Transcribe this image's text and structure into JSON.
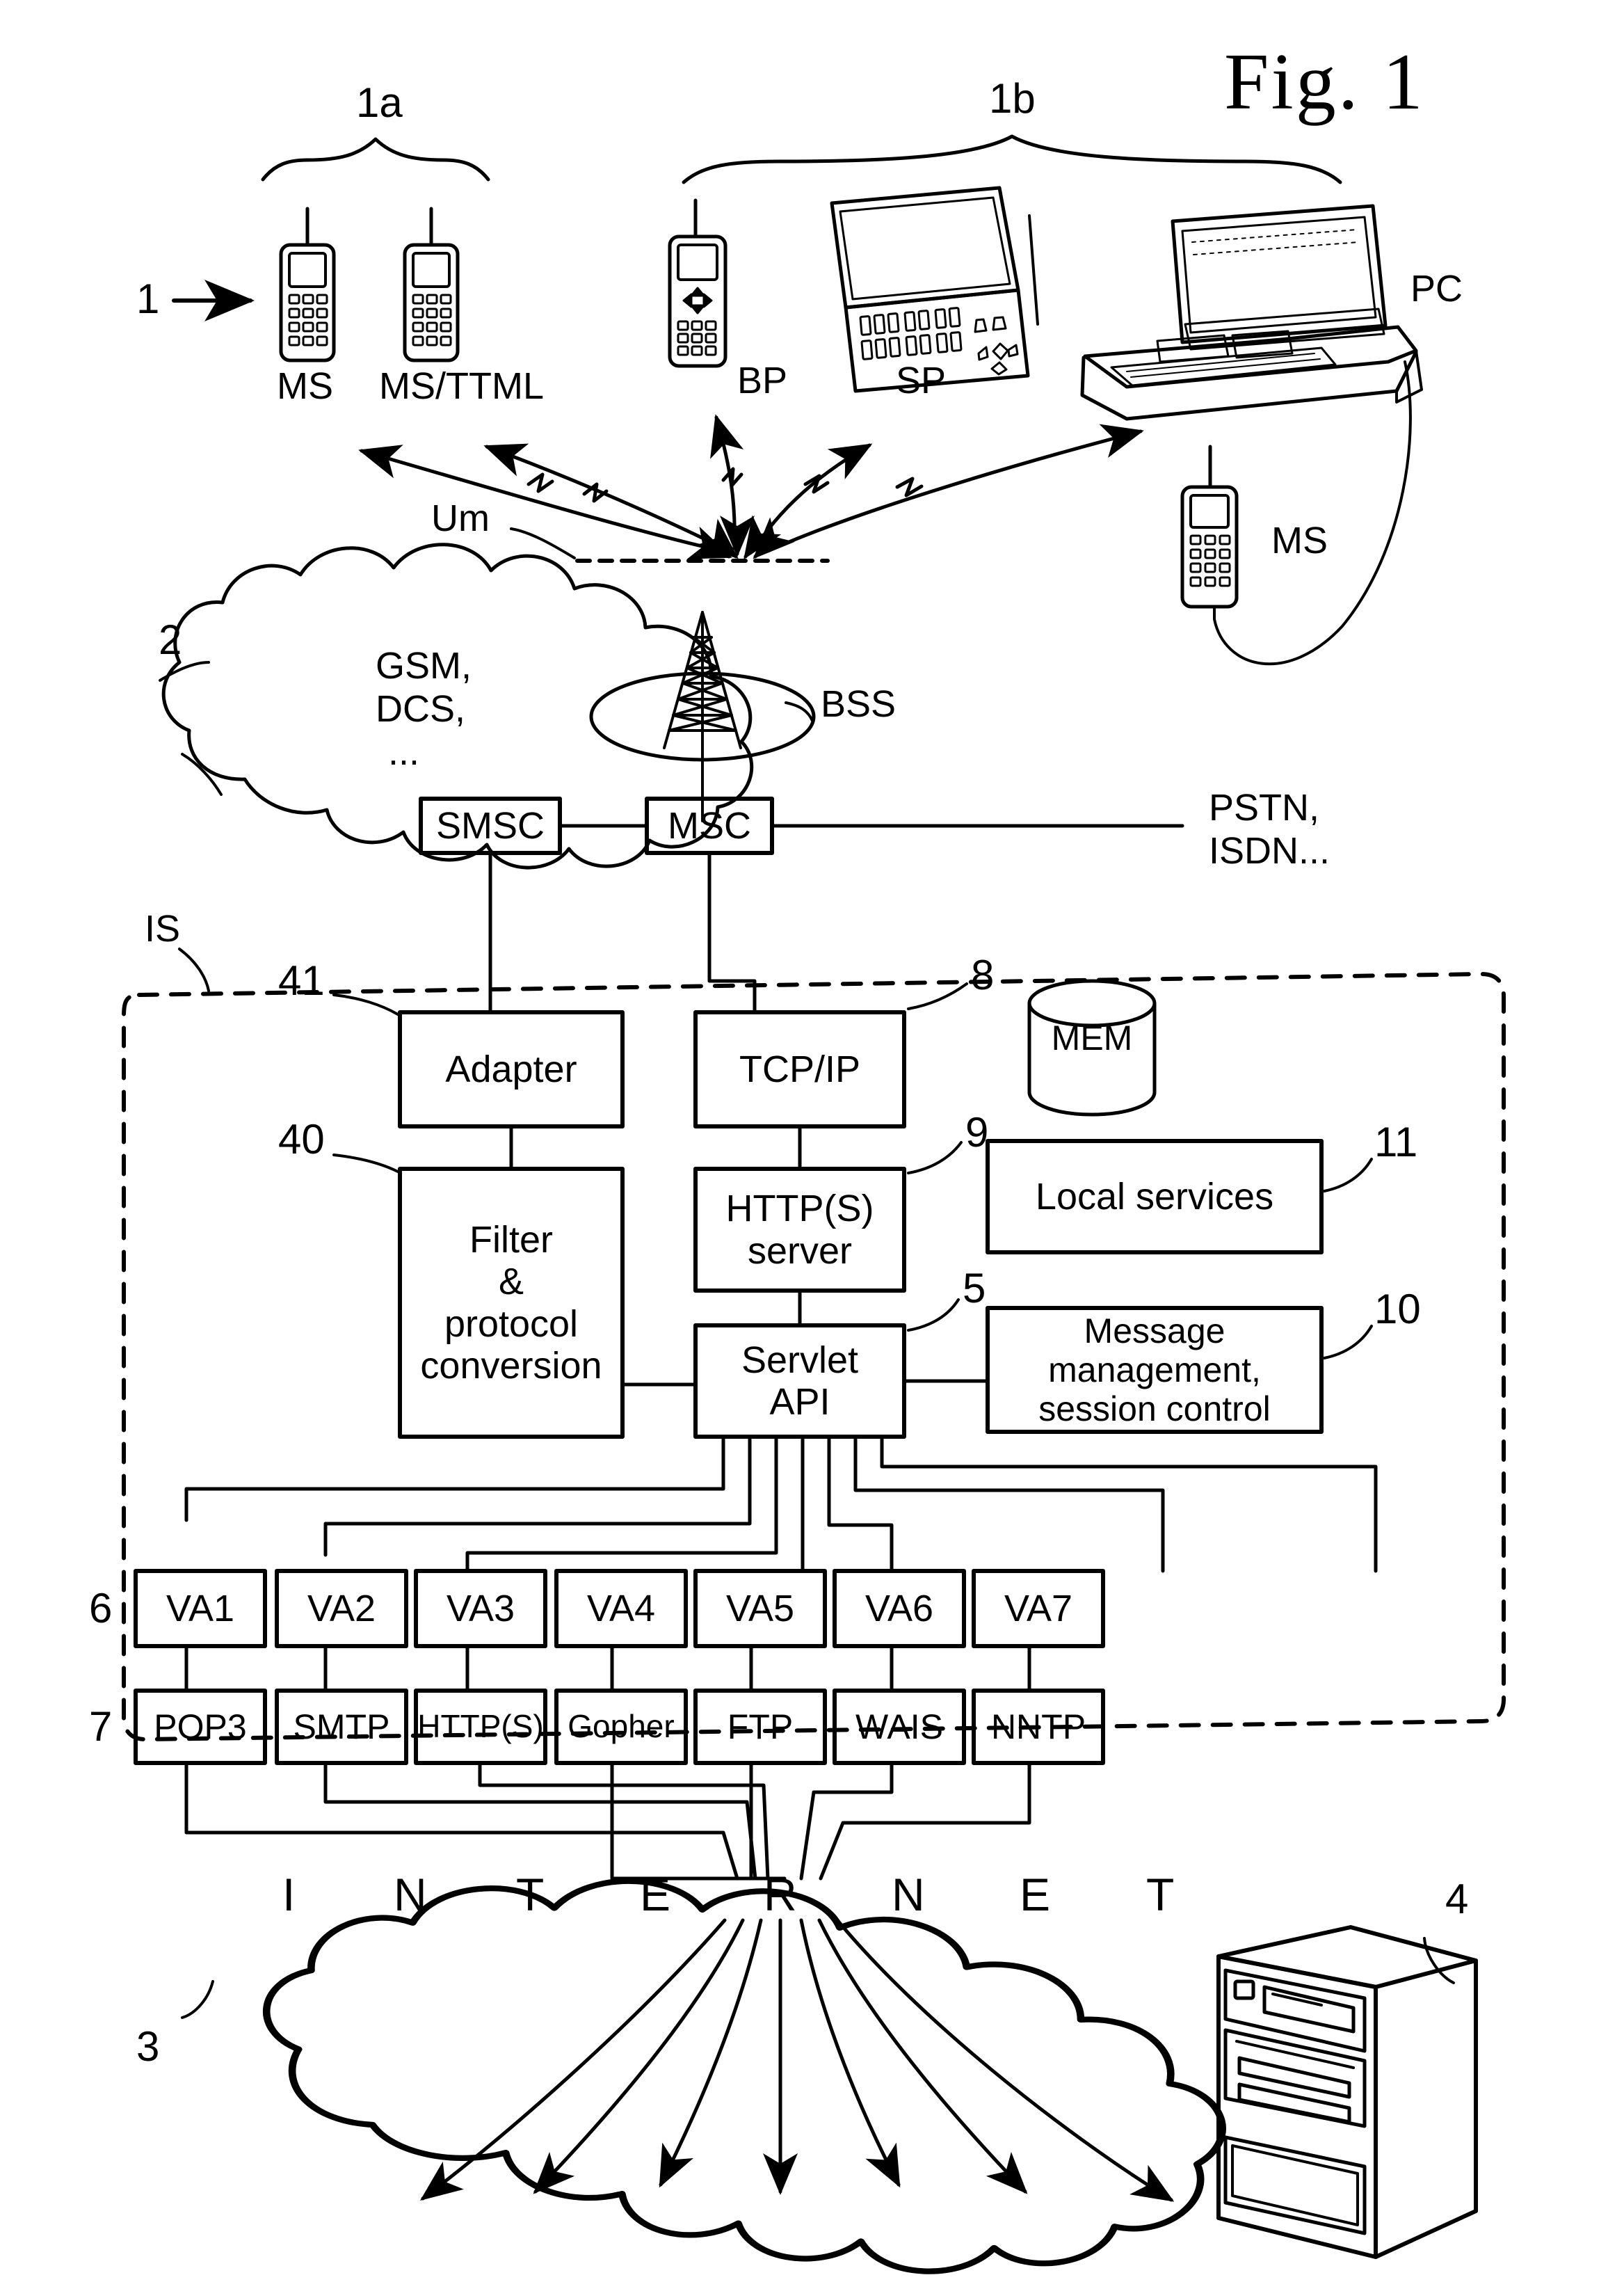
{
  "figure": {
    "title": "Fig. 1",
    "reference_numerals": {
      "terminals": "1",
      "group_a": "1a",
      "group_b": "1b",
      "mobile_network": "2",
      "internet": "3",
      "remote_server": "4",
      "servlet_api": "5",
      "va_row": "6",
      "protocol_row": "7",
      "tcpip": "8",
      "http_server": "9",
      "message_management": "10",
      "local_services": "11",
      "filter": "40",
      "adapter": "41",
      "intelligent_server": "IS"
    }
  },
  "terminals": {
    "group_a_label": "1a",
    "group_b_label": "1b",
    "pointer_label": "1",
    "group_a_devices": [
      {
        "name": "MS",
        "type": "mobile-phone"
      },
      {
        "name": "MS/TTML",
        "type": "mobile-phone"
      }
    ],
    "group_b_devices": [
      {
        "name": "BP",
        "type": "browser-phone"
      },
      {
        "name": "SP",
        "type": "smart-phone-communicator"
      },
      {
        "name": "PC",
        "type": "personal-computer"
      }
    ],
    "attached_phone_label": "MS",
    "air_interface_label": "Um"
  },
  "mobile_network": {
    "ref": "2",
    "cloud_text": [
      "GSM,",
      "DCS,",
      "..."
    ],
    "bss_label": "BSS",
    "nodes": [
      {
        "id": "smsc",
        "label": "SMSC"
      },
      {
        "id": "msc",
        "label": "MSC"
      }
    ],
    "external_networks": [
      "PSTN,",
      "ISDN..."
    ]
  },
  "intelligent_server": {
    "ref": "IS",
    "blocks": [
      {
        "id": "adapter",
        "ref": "41",
        "label": "Adapter"
      },
      {
        "id": "filter",
        "ref": "40",
        "label": "Filter\n&\nprotocol\nconversion",
        "lines": [
          "Filter",
          "&",
          "protocol",
          "conversion"
        ]
      },
      {
        "id": "tcpip",
        "ref": "8",
        "label": "TCP/IP"
      },
      {
        "id": "http",
        "ref": "9",
        "label": "HTTP(S)\nserver",
        "lines": [
          "HTTP(S)",
          "server"
        ]
      },
      {
        "id": "servlet",
        "ref": "5",
        "label": "Servlet\nAPI",
        "lines": [
          "Servlet",
          "API"
        ]
      },
      {
        "id": "local",
        "ref": "11",
        "label": "Local services"
      },
      {
        "id": "msgmgmt",
        "ref": "10",
        "label": "Message management,\nsession control",
        "lines": [
          "Message management,",
          "session control"
        ]
      }
    ],
    "memory": {
      "id": "mem",
      "label": "MEM"
    },
    "va_row_ref": "6",
    "va_blocks": [
      {
        "label": "VA1"
      },
      {
        "label": "VA2"
      },
      {
        "label": "VA3"
      },
      {
        "label": "VA4"
      },
      {
        "label": "VA5"
      },
      {
        "label": "VA6"
      },
      {
        "label": "VA7"
      }
    ],
    "protocol_row_ref": "7",
    "protocol_blocks": [
      {
        "label": "POP3"
      },
      {
        "label": "SMTP"
      },
      {
        "label": "HTTP(S)"
      },
      {
        "label": "Gopher"
      },
      {
        "label": "FTP"
      },
      {
        "label": "WAIS"
      },
      {
        "label": "NNTP"
      }
    ]
  },
  "internet": {
    "ref": "3",
    "server_ref": "4",
    "letters": [
      "I",
      "N",
      "T",
      "E",
      "R",
      "N",
      "E",
      "T"
    ]
  },
  "colors": {
    "ink": "#000000",
    "paper": "#ffffff"
  }
}
